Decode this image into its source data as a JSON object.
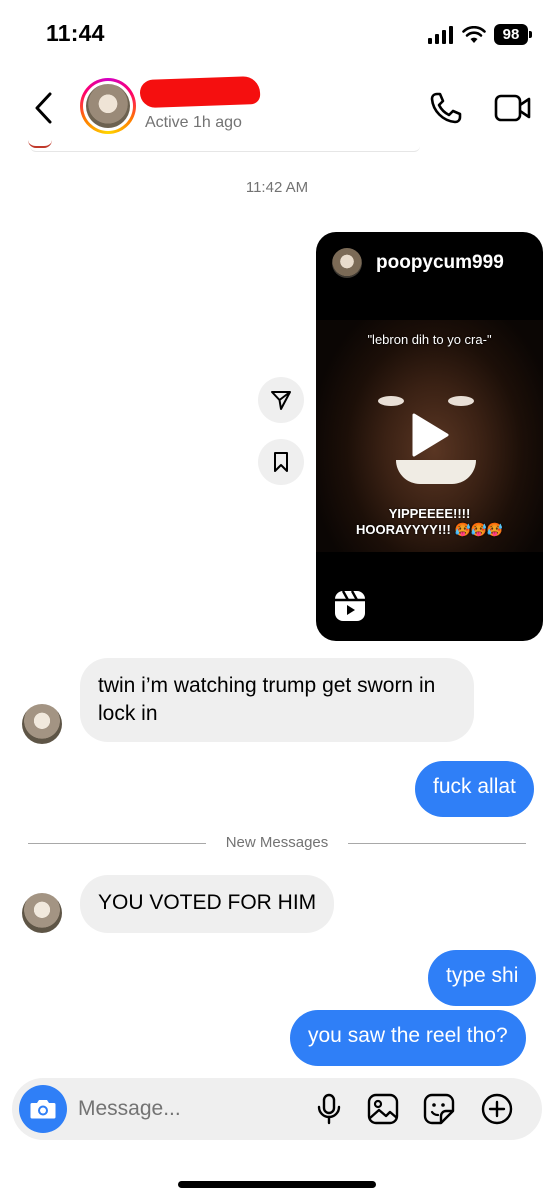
{
  "status": {
    "time": "11:44",
    "battery": "98"
  },
  "header": {
    "active_status": "Active 1h ago"
  },
  "timestamp": "11:42 AM",
  "reel": {
    "owner": "poopycum999",
    "caption_top": "\"lebron dih to yo cra-\"",
    "caption_bottom_line1": "YIPPEEEE!!!!",
    "caption_bottom_line2": "HOORAYYYY!!! 🥵🥵🥵"
  },
  "messages": {
    "incoming_1": "twin i’m watching trump get sworn in lock in",
    "outgoing_1": "fuck allat",
    "divider": "New Messages",
    "incoming_2": "YOU VOTED FOR HIM",
    "outgoing_2": "type shi",
    "outgoing_3": "you saw the reel tho?"
  },
  "composer": {
    "placeholder": "Message..."
  },
  "colors": {
    "outgoing_bubble": "#2f7ff7",
    "incoming_bubble": "#efefef",
    "accent": "#2f7ff7"
  },
  "icons": [
    "back-icon",
    "phone-icon",
    "video-camera-icon",
    "share-icon",
    "bookmark-icon",
    "play-icon",
    "reels-icon",
    "camera-icon",
    "microphone-icon",
    "gallery-icon",
    "sticker-icon",
    "plus-icon"
  ]
}
